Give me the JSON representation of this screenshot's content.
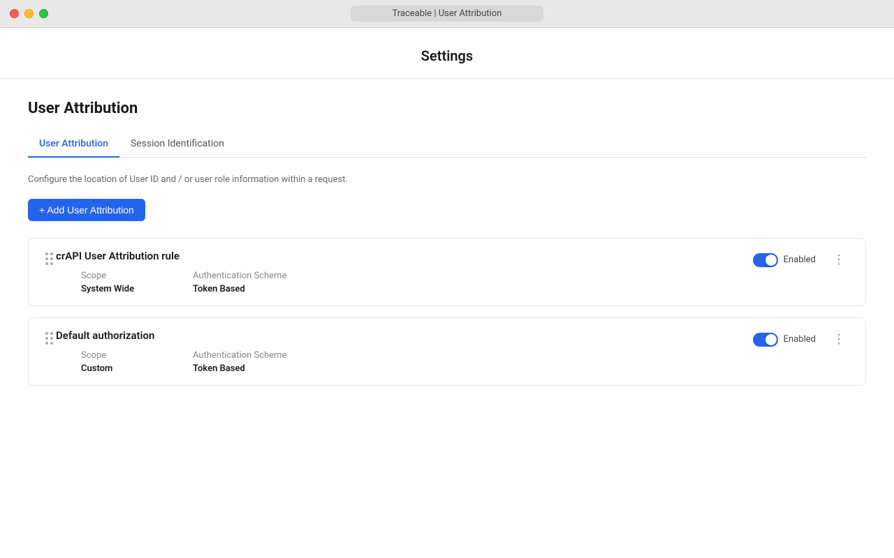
{
  "titlebar": {
    "title": "Traceable | User Attribution"
  },
  "settings": {
    "heading": "Settings"
  },
  "page": {
    "title": "User Attribution",
    "description": "Configure the location of User ID and / or user role information within a request."
  },
  "tabs": [
    {
      "id": "user-attribution",
      "label": "User Attribution",
      "active": true
    },
    {
      "id": "session-identification",
      "label": "Session Identification",
      "active": false
    }
  ],
  "add_button": {
    "label": "+ Add User Attribution"
  },
  "rules": [
    {
      "id": "rule-1",
      "title": "crAPI User Attribution rule",
      "scope_label": "Scope",
      "scope_value": "System Wide",
      "auth_label": "Authentication Scheme",
      "auth_value": "Token Based",
      "enabled": true,
      "enabled_label": "Enabled"
    },
    {
      "id": "rule-2",
      "title": "Default authorization",
      "scope_label": "Scope",
      "scope_value": "Custom",
      "auth_label": "Authentication Scheme",
      "auth_value": "Token Based",
      "enabled": true,
      "enabled_label": "Enabled"
    }
  ],
  "colors": {
    "accent": "#2563eb",
    "toggle_on": "#2563eb"
  }
}
